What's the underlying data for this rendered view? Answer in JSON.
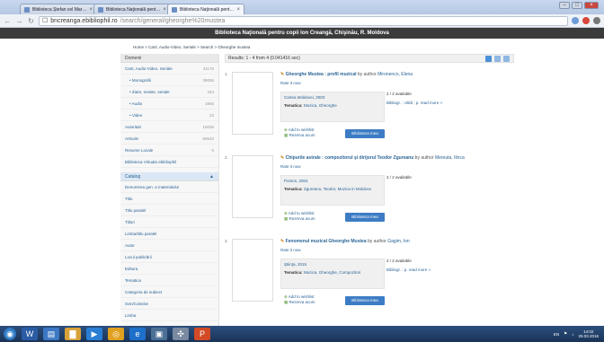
{
  "browser": {
    "tabs": [
      {
        "label": "Biblioteca Ștefan cel Mare..."
      },
      {
        "label": "Biblioteca Naţională pentru..."
      },
      {
        "label": "Biblioteca Naţională pentru..."
      }
    ],
    "url": {
      "host": "bncreanga.ebibliophil.ro",
      "path": "/search/general/gheorghe%20mustea"
    }
  },
  "site": {
    "header": "Biblioteca Naţională pentru copii Ion Creangă, Chişinău, R. Moldova"
  },
  "breadcrumb": "Home > Carti, Audio-Video, Seriale > Search > Gheorghe mustea",
  "sidebar": {
    "domains_header": "Domenii",
    "domains": [
      {
        "label": "Carti, Audio-Video, Seriale",
        "count": "41176",
        "sub": false
      },
      {
        "label": "Monografii",
        "count": "39065",
        "sub": true
      },
      {
        "label": "Ziare, reviste, seriale",
        "count": "424",
        "sub": true
      },
      {
        "label": "Audio",
        "count": "1665",
        "sub": true
      },
      {
        "label": "Video",
        "count": "22",
        "sub": true
      },
      {
        "label": "Autoritati",
        "count": "10035",
        "sub": false
      },
      {
        "label": "Articole",
        "count": "59640",
        "sub": false
      },
      {
        "label": "Resurse Locale",
        "count": "0",
        "sub": false
      },
      {
        "label": "Biblioteca Virtuala ebibliophil",
        "count": "",
        "sub": false
      }
    ],
    "catalog_header": "Catalog",
    "catalog": [
      "Denumirea gen. a materialului",
      "Titlu",
      "Titlu paralel",
      "Titluri",
      "Limba/titlu paralel",
      "Autor",
      "Locul publicării",
      "Editura",
      "Tematica",
      "Categoria de subiect",
      "Gen/Colectie",
      "Limba"
    ]
  },
  "results": {
    "summary": "Results: 1 - 4 from 4 (0.041416 sec)",
    "records": [
      {
        "num": "1.",
        "title": "Gheorghe Mustea : profil muzical",
        "by": " by author ",
        "author": "Mironenco, Elena",
        "rate": "Rate it now",
        "pub": "Cartea Moldovei, 2003",
        "tematica_label": "Tematica:",
        "tematica": "Muzica, Gheorghe",
        "availability": "2 / 2 available",
        "location": "Bibliogr. : citită ; p. read more »",
        "wishlist": "Add to wishlist",
        "reserve": "Rezerva acum",
        "button": "Biblioteca mea"
      },
      {
        "num": "2.",
        "title": "Chipurile astrale : compozitorul şi dirijorul Teodor Zgureanu",
        "by": " by author ",
        "author": "Mereuta, Ilinca",
        "rate": "Rate it now",
        "pub": "Pontos, 2004",
        "tematica_label": "Tematica:",
        "tematica": "Zgureanu, Teodor, Muzica in Moldova",
        "availability": "2 / 2 available",
        "location": "",
        "wishlist": "Add to wishlist",
        "reserve": "Rezerva acum",
        "button": "Biblioteca mea"
      },
      {
        "num": "3.",
        "title": "Fenomenul muzical Gheorghe Mustea",
        "by": " by author ",
        "author": "Gagim, Ion",
        "rate": "Rate it now",
        "pub": "Ştiinţa, 2015",
        "tematica_label": "Tematica:",
        "tematica": "Muzica, Gheorghe, Compozitori",
        "availability": "2 / 2 available",
        "location": "Bibliogr. : p. read more »",
        "wishlist": "Add to wishlist",
        "reserve": "Rezerva acum",
        "button": "Biblioteca mea"
      }
    ]
  },
  "taskbar": {
    "lang": "EN",
    "time": "14:02",
    "date": "29.03.2016"
  }
}
